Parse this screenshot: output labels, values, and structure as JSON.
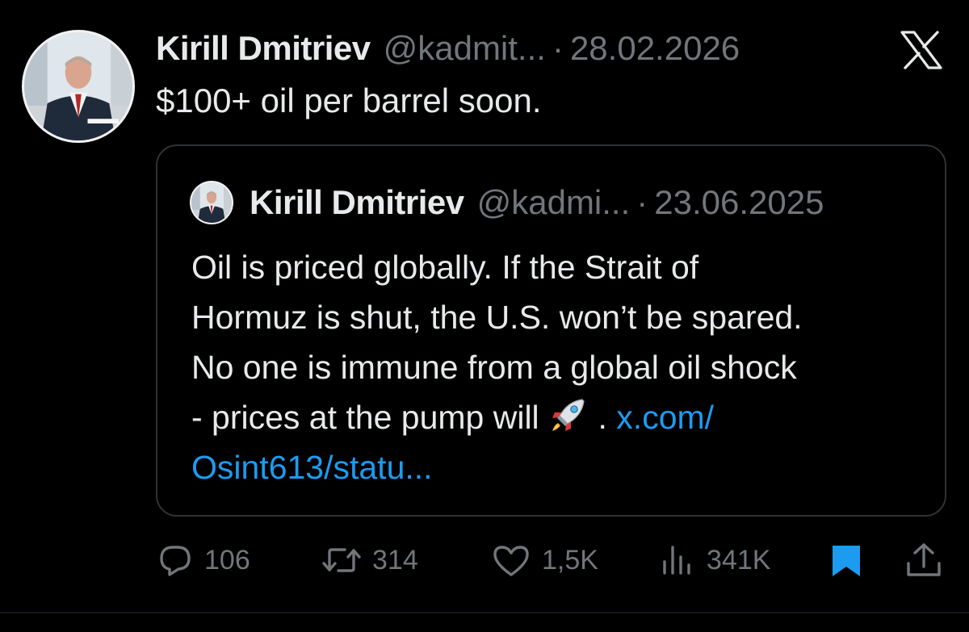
{
  "tweet": {
    "author_name": "Kirill Dmitriev",
    "author_handle": "@kadmit...",
    "separator": "·",
    "date": "28.02.2026",
    "text": "$100+ oil per barrel soon."
  },
  "quoted_tweet": {
    "author_name": "Kirill Dmitriev",
    "author_handle": "@kadmi...",
    "separator": "·",
    "date": "23.06.2025",
    "lines": [
      "Oil is priced globally. If the Strait of",
      "Hormuz is shut, the U.S. won’t be spared.",
      "No one is immune from a global oil shock"
    ],
    "line4_prefix": "- prices at the pump will",
    "rocket_icon": "rocket-emoji",
    "line4_suffix": ".",
    "link_part1": "x.com/",
    "link_part2": "Osint613/statu..."
  },
  "actions": {
    "replies": "106",
    "reposts": "314",
    "likes": "1,5K",
    "views": "341K"
  },
  "icons": {
    "close": "x-logo-icon",
    "reply": "reply-icon",
    "repost": "repost-icon",
    "like": "heart-icon",
    "views": "views-icon",
    "bookmark": "bookmark-icon",
    "share": "share-icon"
  },
  "colors": {
    "background": "#000000",
    "text": "#e7e9ea",
    "muted": "#71767b",
    "link": "#1d9bf0",
    "border": "#2f3336"
  }
}
